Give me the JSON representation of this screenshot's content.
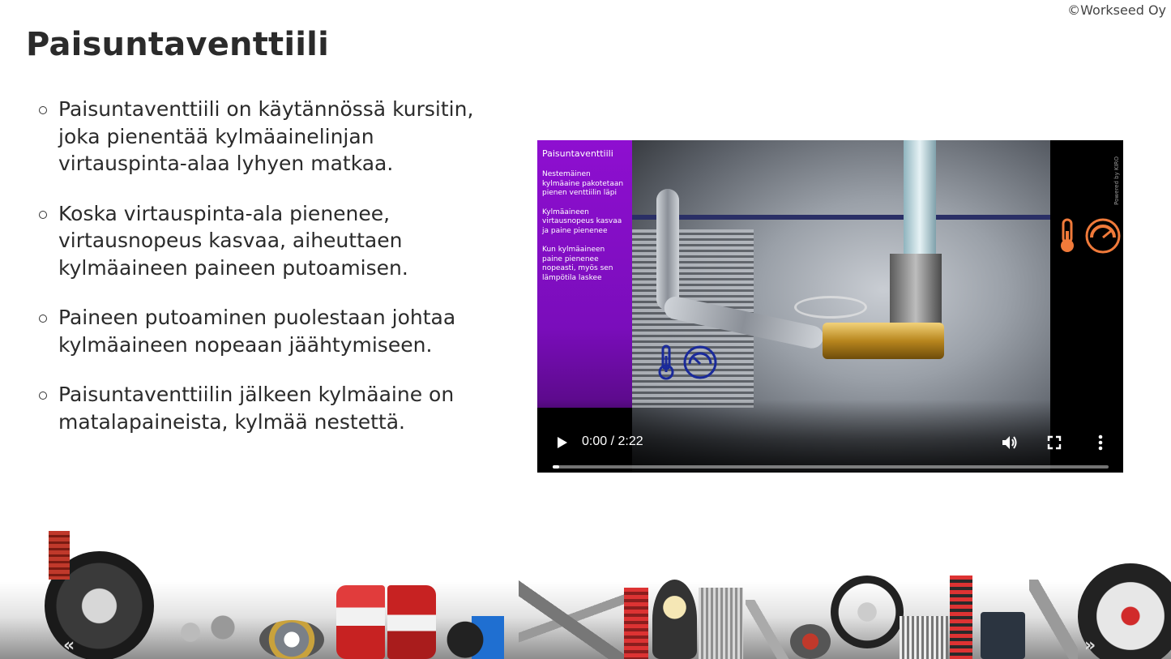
{
  "copyright": "©Workseed Oy",
  "title": "Paisuntaventtiili",
  "bullets": [
    "Paisuntaventtiili on käytännössä kursitin, joka pienentää kylmäainelinjan virtauspinta-alaa lyhyen matkaa.",
    "Koska virtauspinta-ala pienenee, virtausnopeus kasvaa, aiheuttaen kylmäaineen paineen putoamisen.",
    "Paineen putoaminen puolestaan johtaa kylmäaineen nopeaan jäähtymiseen.",
    "Paisuntaventtiilin jälkeen kylmäaine on matalapaineista, kylmää nestettä."
  ],
  "video": {
    "panel_title": "Paisuntaventtiili",
    "panel_lines": [
      "Nestemäinen kylmäaine pakotetaan pienen venttiilin läpi",
      "Kylmäaineen virtausnopeus kasvaa ja paine pienenee",
      "Kun kylmäaineen paine pienenee nopeasti, myös sen lämpötila laskee"
    ],
    "powered_by": "Powered by KIRO",
    "time": "0:00 / 2:22",
    "progress": 0.0,
    "colors": {
      "panel": "#8e0fd0",
      "gauge_orange": "#f07a3a",
      "gauge_blue": "#1a2a9a"
    }
  },
  "icons": {
    "play": "play-icon",
    "volume": "volume-icon",
    "fullscreen": "fullscreen-icon",
    "more": "more-vert-icon",
    "thermometer": "thermometer-icon",
    "gauge": "pressure-gauge-icon"
  },
  "carousel": {
    "prev": "«",
    "next": "»"
  }
}
